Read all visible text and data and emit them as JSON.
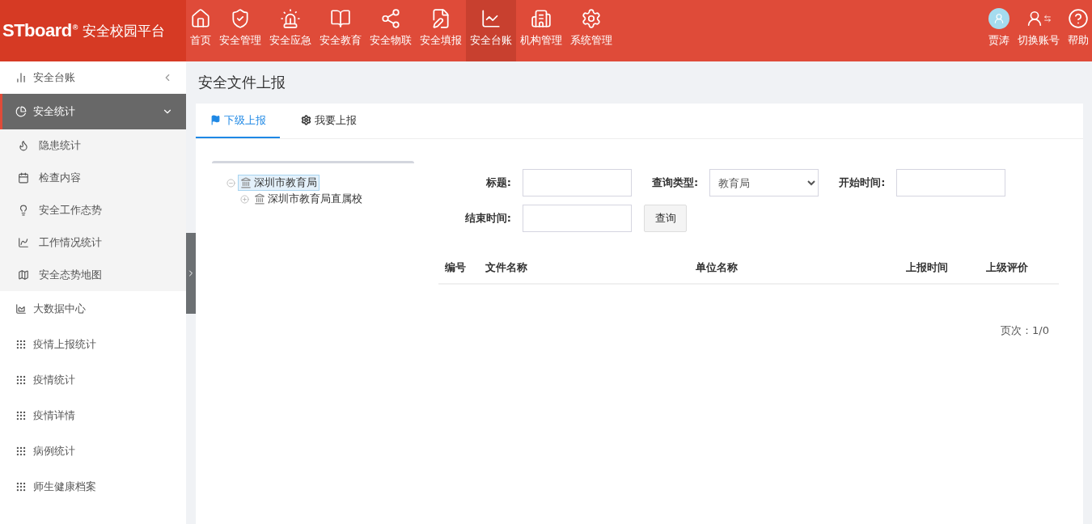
{
  "header": {
    "logo": {
      "brand": "STboard",
      "mark": "®",
      "text": "安全校园平台"
    },
    "nav": [
      {
        "label": "首页",
        "kind": "home",
        "selected": false
      },
      {
        "label": "安全管理",
        "kind": "shield",
        "selected": false
      },
      {
        "label": "安全应急",
        "kind": "siren",
        "selected": false
      },
      {
        "label": "安全教育",
        "kind": "book",
        "selected": false
      },
      {
        "label": "安全物联",
        "kind": "network",
        "selected": false
      },
      {
        "label": "安全填报",
        "kind": "form",
        "selected": false
      },
      {
        "label": "安全台账",
        "kind": "chart",
        "selected": true
      },
      {
        "label": "机构管理",
        "kind": "building",
        "selected": false
      },
      {
        "label": "系统管理",
        "kind": "settings",
        "selected": false
      }
    ],
    "actions": [
      {
        "label": "贾涛",
        "kind": "avatar"
      },
      {
        "label": "切换账号",
        "kind": "switch"
      },
      {
        "label": "帮助",
        "kind": "help"
      }
    ]
  },
  "sidebar": {
    "items": [
      {
        "label": "安全台账",
        "kind": "bars",
        "expanded": false,
        "selected": false
      },
      {
        "label": "安全统计",
        "kind": "pie",
        "expanded": true,
        "selected": true,
        "children": [
          {
            "label": "隐患统计",
            "kind": "flame"
          },
          {
            "label": "检查内容",
            "kind": "calendar"
          },
          {
            "label": "安全工作态势",
            "kind": "bulb"
          },
          {
            "label": "工作情况统计",
            "kind": "line"
          },
          {
            "label": "安全态势地图",
            "kind": "map"
          }
        ]
      },
      {
        "label": "大数据中心",
        "kind": "area",
        "selected": false
      },
      {
        "label": "疫情上报统计",
        "kind": "grid",
        "selected": false
      },
      {
        "label": "疫情统计",
        "kind": "grid",
        "selected": false
      },
      {
        "label": "疫情详情",
        "kind": "grid",
        "selected": false
      },
      {
        "label": "病例统计",
        "kind": "grid",
        "selected": false
      },
      {
        "label": "师生健康档案",
        "kind": "grid",
        "selected": false
      }
    ]
  },
  "main": {
    "title": "安全文件上报",
    "tabs": [
      {
        "label": "下级上报",
        "kind": "flag",
        "selected": true
      },
      {
        "label": "我要上报",
        "kind": "gear",
        "selected": false
      }
    ],
    "tree": [
      {
        "label": "深圳市教育局",
        "expanded": true,
        "selected": true,
        "children": [
          {
            "label": "深圳市教育局直属校",
            "expanded": false,
            "selected": false
          }
        ]
      }
    ],
    "form": {
      "rows": [
        [
          {
            "label": "标题:",
            "kind": "text"
          },
          {
            "label": "查询类型:",
            "kind": "select",
            "value": "教育局"
          },
          {
            "label": "开始时间:",
            "kind": "text"
          }
        ],
        [
          {
            "label": "结束时间:",
            "kind": "text"
          }
        ]
      ],
      "button": "查询"
    },
    "table": {
      "columns": [
        "编号",
        "文件名称",
        "单位名称",
        "上报时间",
        "上级评价"
      ]
    },
    "pager": "页次：1/0"
  }
}
